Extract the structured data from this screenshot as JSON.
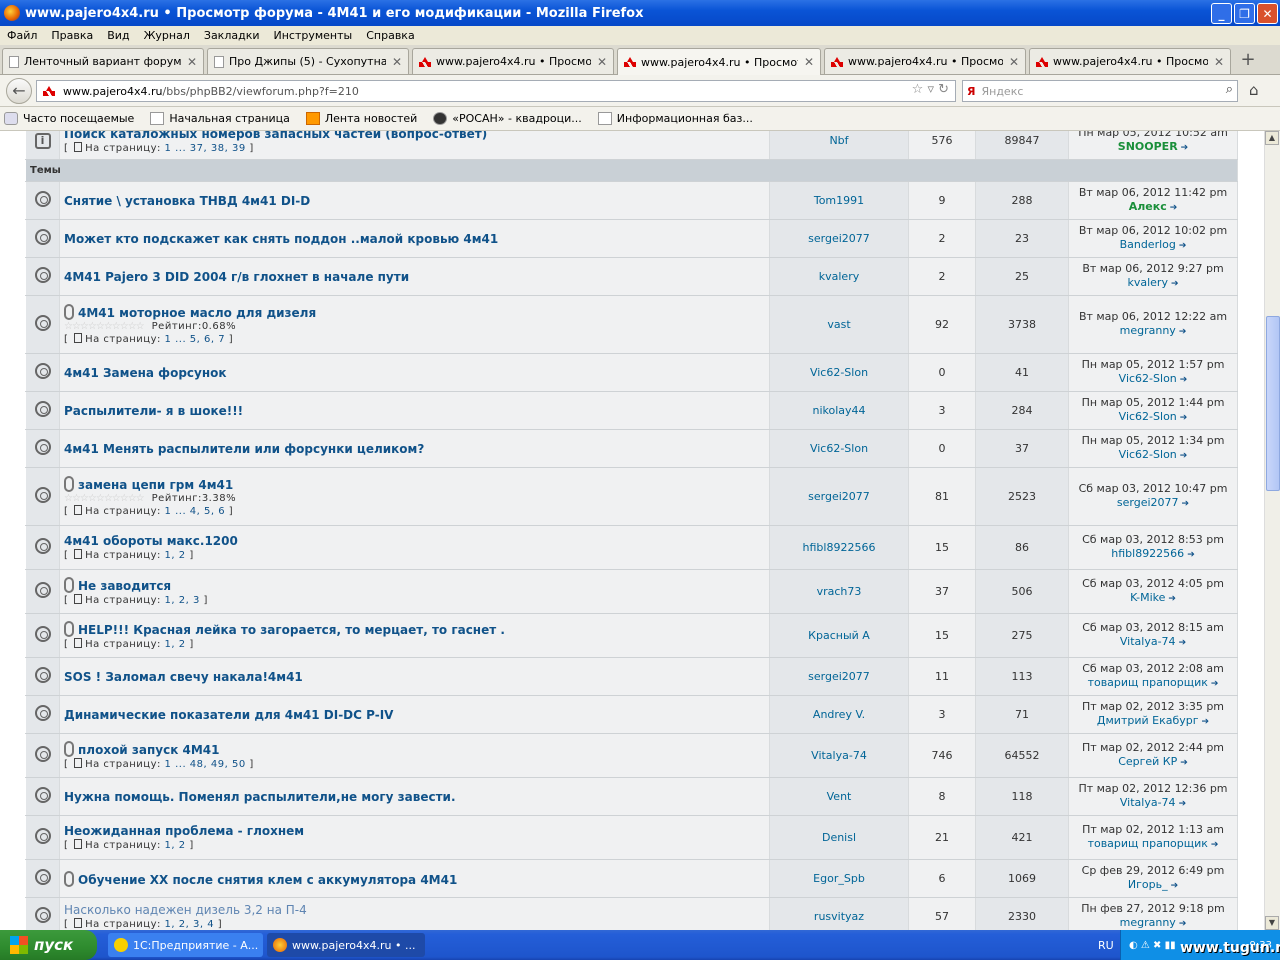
{
  "window": {
    "title": "www.pajero4x4.ru • Просмотр форума - 4M41 и его модификации - Mozilla Firefox"
  },
  "menu": [
    "Файл",
    "Правка",
    "Вид",
    "Журнал",
    "Закладки",
    "Инструменты",
    "Справка"
  ],
  "tabs": [
    {
      "label": "Ленточный вариант форума - ..."
    },
    {
      "label": "Про Джипы (5) - Сухопутная ..."
    },
    {
      "label": "www.pajero4x4.ru • Просмотр ..."
    },
    {
      "label": "www.pajero4x4.ru • Просмотр ..."
    },
    {
      "label": "www.pajero4x4.ru • Просмотр ..."
    },
    {
      "label": "www.pajero4x4.ru • Просмотр ..."
    }
  ],
  "nav": {
    "url_domain": "www.pajero4x4.ru",
    "url_path": "/bbs/phpBB2/viewforum.php?f=210",
    "search_placeholder": "Яндекс",
    "search_engine": "Я"
  },
  "bookmarks": [
    "Часто посещаемые",
    "Начальная страница",
    "Лента новостей",
    "«РОСАН» - квадроци...",
    "Информационная баз..."
  ],
  "forum": {
    "announce": {
      "title": "Поиск каталожных номеров запасных частей (вопрос-ответ)",
      "pages_prefix": "На страницу:",
      "pages": "1 ... 37, 38, 39",
      "author": "Nbf",
      "replies": "576",
      "views": "89847",
      "last_date": "Пн мар 05, 2012 10:52 am",
      "last_author": "SNOOPER"
    },
    "section_label": "Темы",
    "topics": [
      {
        "title": "Снятие \\ установка ТНВД 4м41 DI-D",
        "author": "Tom1991",
        "replies": "9",
        "views": "288",
        "last_date": "Вт мар 06, 2012 11:42 pm",
        "last_author": "Алекс"
      },
      {
        "title": "Может кто подскажет как снять поддон ..малой кровью 4м41",
        "author": "sergei2077",
        "replies": "2",
        "views": "23",
        "last_date": "Вт мар 06, 2012 10:02 pm",
        "last_author": "Banderlog"
      },
      {
        "title": "4M41 Pajero 3 DID 2004 г/в глохнет в начале пути",
        "author": "kvalery",
        "replies": "2",
        "views": "25",
        "last_date": "Вт мар 06, 2012 9:27 pm",
        "last_author": "kvalery"
      },
      {
        "title": "4M41 моторное масло для дизеля",
        "author": "vast",
        "replies": "92",
        "views": "3738",
        "last_date": "Вт мар 06, 2012 12:22 am",
        "last_author": "megranny",
        "rating": "Рейтинг:0.68%",
        "pages": "1 ... 5, 6, 7"
      },
      {
        "title": "4м41 Замена форсунок",
        "author": "Vic62-Slon",
        "replies": "0",
        "views": "41",
        "last_date": "Пн мар 05, 2012 1:57 pm",
        "last_author": "Vic62-Slon"
      },
      {
        "title": "Распылители- я в шоке!!!",
        "author": "nikolay44",
        "replies": "3",
        "views": "284",
        "last_date": "Пн мар 05, 2012 1:44 pm",
        "last_author": "Vic62-Slon"
      },
      {
        "title": "4м41 Менять распылители или форсунки целиком?",
        "author": "Vic62-Slon",
        "replies": "0",
        "views": "37",
        "last_date": "Пн мар 05, 2012 1:34 pm",
        "last_author": "Vic62-Slon"
      },
      {
        "title": "замена цепи грм 4м41",
        "author": "sergei2077",
        "replies": "81",
        "views": "2523",
        "last_date": "Сб мар 03, 2012 10:47 pm",
        "last_author": "sergei2077",
        "rating": "Рейтинг:3.38%",
        "pages": "1 ... 4, 5, 6"
      },
      {
        "title": "4м41 обороты макс.1200",
        "author": "hfibl8922566",
        "replies": "15",
        "views": "86",
        "last_date": "Сб мар 03, 2012 8:53 pm",
        "last_author": "hfibl8922566",
        "pages": "1, 2"
      },
      {
        "title": "Не заводится",
        "author": "vrach73",
        "replies": "37",
        "views": "506",
        "last_date": "Сб мар 03, 2012 4:05 pm",
        "last_author": "K-Mike",
        "pages": "1, 2, 3"
      },
      {
        "title": "HELP!!! Красная лейка то загорается, то мерцает, то гаснет .",
        "author": "Красный А",
        "replies": "15",
        "views": "275",
        "last_date": "Сб мар 03, 2012 8:15 am",
        "last_author": "Vitalya-74",
        "pages": "1, 2"
      },
      {
        "title": "SOS ! Заломал свечу накала!4м41",
        "author": "sergei2077",
        "replies": "11",
        "views": "113",
        "last_date": "Сб мар 03, 2012 2:08 am",
        "last_author": "товарищ прапорщик"
      },
      {
        "title": "Динамические показатели для 4м41 DI-DC P-IV",
        "author": "Andrey V.",
        "replies": "3",
        "views": "71",
        "last_date": "Пт мар 02, 2012 3:35 pm",
        "last_author": "Дмитрий Екабург"
      },
      {
        "title": "плохой запуск 4М41",
        "author": "Vitalya-74",
        "replies": "746",
        "views": "64552",
        "last_date": "Пт мар 02, 2012 2:44 pm",
        "last_author": "Сергей КР",
        "pages": "1 ... 48, 49, 50"
      },
      {
        "title": "Нужна помощь. Поменял распылители,не могу завести.",
        "author": "Vent",
        "replies": "8",
        "views": "118",
        "last_date": "Пт мар 02, 2012 12:36 pm",
        "last_author": "Vitalya-74"
      },
      {
        "title": "Неожиданная проблема - глохнем",
        "author": "Denisl",
        "replies": "21",
        "views": "421",
        "last_date": "Пт мар 02, 2012 1:13 am",
        "last_author": "товарищ прапорщик",
        "pages": "1, 2"
      },
      {
        "title": "Обучение XX после снятия клем с аккумулятора 4M41",
        "author": "Egor_Spb",
        "replies": "6",
        "views": "1069",
        "last_date": "Ср фев 29, 2012 6:49 pm",
        "last_author": "Игорь_"
      },
      {
        "title": "Насколько надежен дизель 3,2 на П-4",
        "author": "rusvityaz",
        "replies": "57",
        "views": "2330",
        "last_date": "Пн фев 27, 2012 9:18 pm",
        "last_author": "megranny",
        "pages": "1, 2, 3, 4"
      }
    ]
  },
  "taskbar": {
    "start": "пуск",
    "tasks": [
      "1С:Предприятие - А...",
      "www.pajero4x4.ru • ..."
    ],
    "lang": "RU",
    "clock": "9:33"
  },
  "watermark": "www.tugun.ru"
}
